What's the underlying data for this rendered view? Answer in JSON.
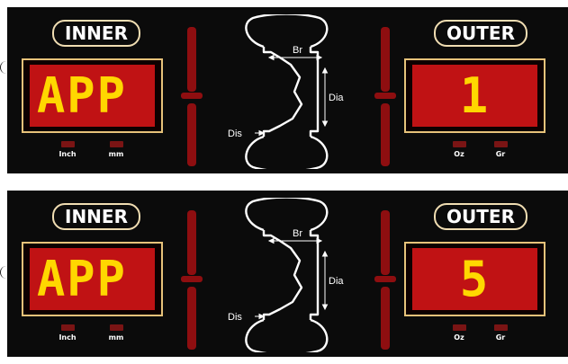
{
  "panels": [
    {
      "inner_label": "INNER",
      "outer_label": "OUTER",
      "inner_display": "APP",
      "outer_display": "1",
      "inner_units": [
        "Inch",
        "mm"
      ],
      "outer_units": [
        "Oz",
        "Gr"
      ],
      "wheel_labels": {
        "br": "Br",
        "dia": "Dia",
        "dis": "Dis"
      }
    },
    {
      "inner_label": "INNER",
      "outer_label": "OUTER",
      "inner_display": "APP",
      "outer_display": "5",
      "inner_units": [
        "Inch",
        "mm"
      ],
      "outer_units": [
        "Oz",
        "Gr"
      ],
      "wheel_labels": {
        "br": "Br",
        "dia": "Dia",
        "dis": "Dis"
      }
    }
  ],
  "colors": {
    "panel_bg": "#0b0b0b",
    "screen_red": "#c01214",
    "digit_yellow": "#ffd700",
    "frame_gold": "#e6c27a",
    "bar_red": "#8e0e10"
  }
}
